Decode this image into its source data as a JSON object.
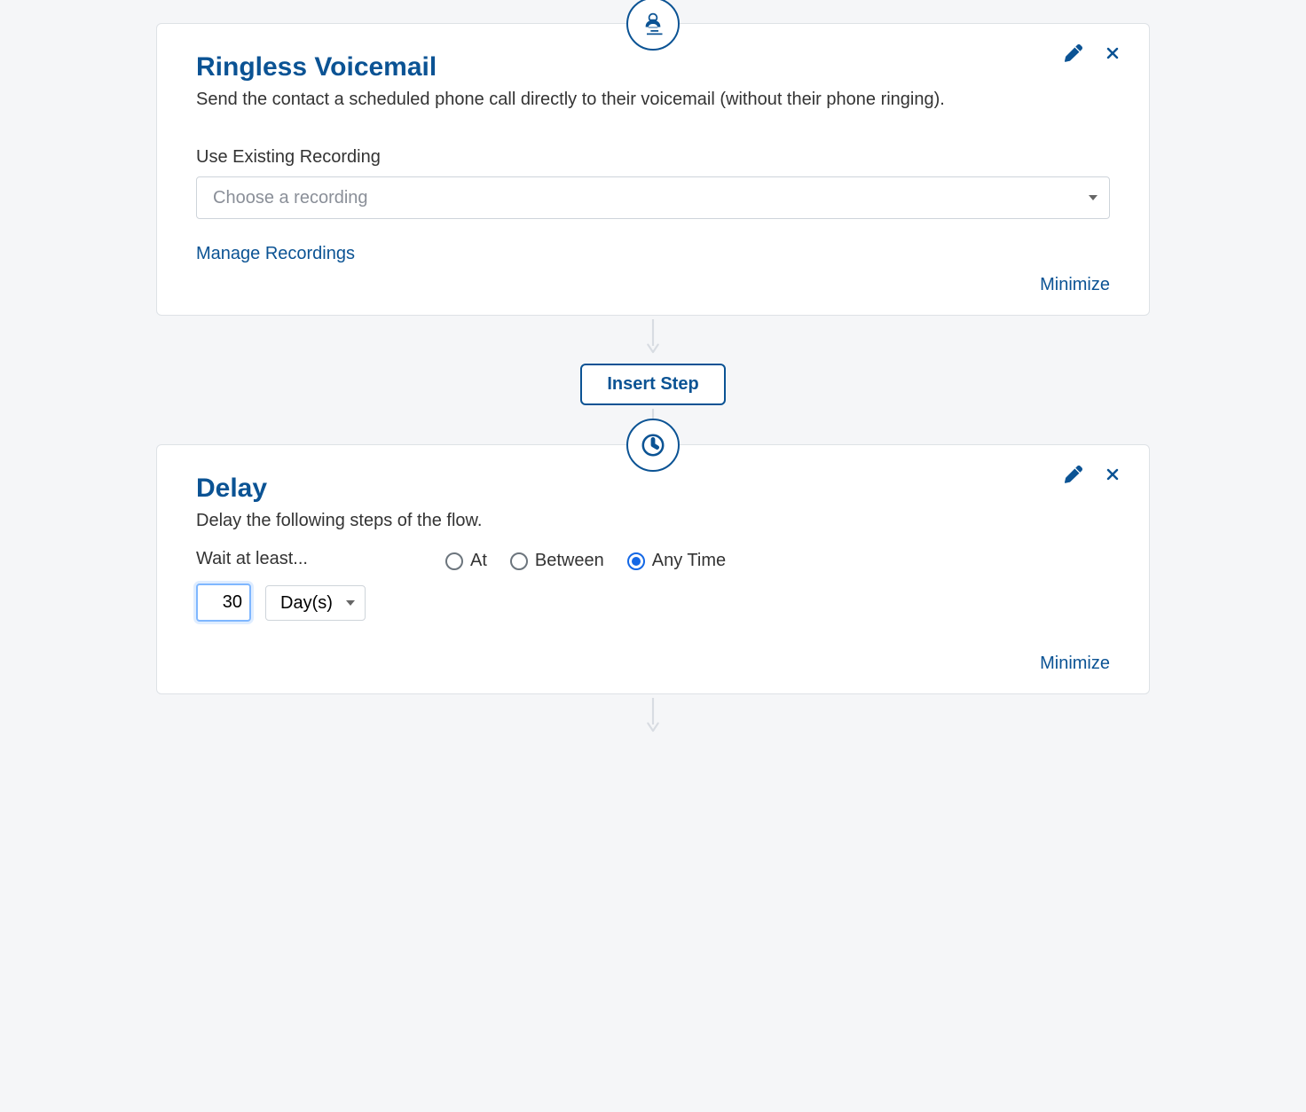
{
  "card1": {
    "title": "Ringless Voicemail",
    "desc": "Send the contact a scheduled phone call directly to their voicemail (without their phone ringing).",
    "field_label": "Use Existing Recording",
    "select_placeholder": "Choose a recording",
    "manage_link": "Manage Recordings",
    "minimize": "Minimize"
  },
  "insert_label": "Insert Step",
  "card2": {
    "title": "Delay",
    "desc": "Delay the following steps of the flow.",
    "wait_label": "Wait at least...",
    "wait_value": "30",
    "unit": "Day(s)",
    "radios": {
      "at": "At",
      "between": "Between",
      "any": "Any Time"
    },
    "minimize": "Minimize"
  }
}
